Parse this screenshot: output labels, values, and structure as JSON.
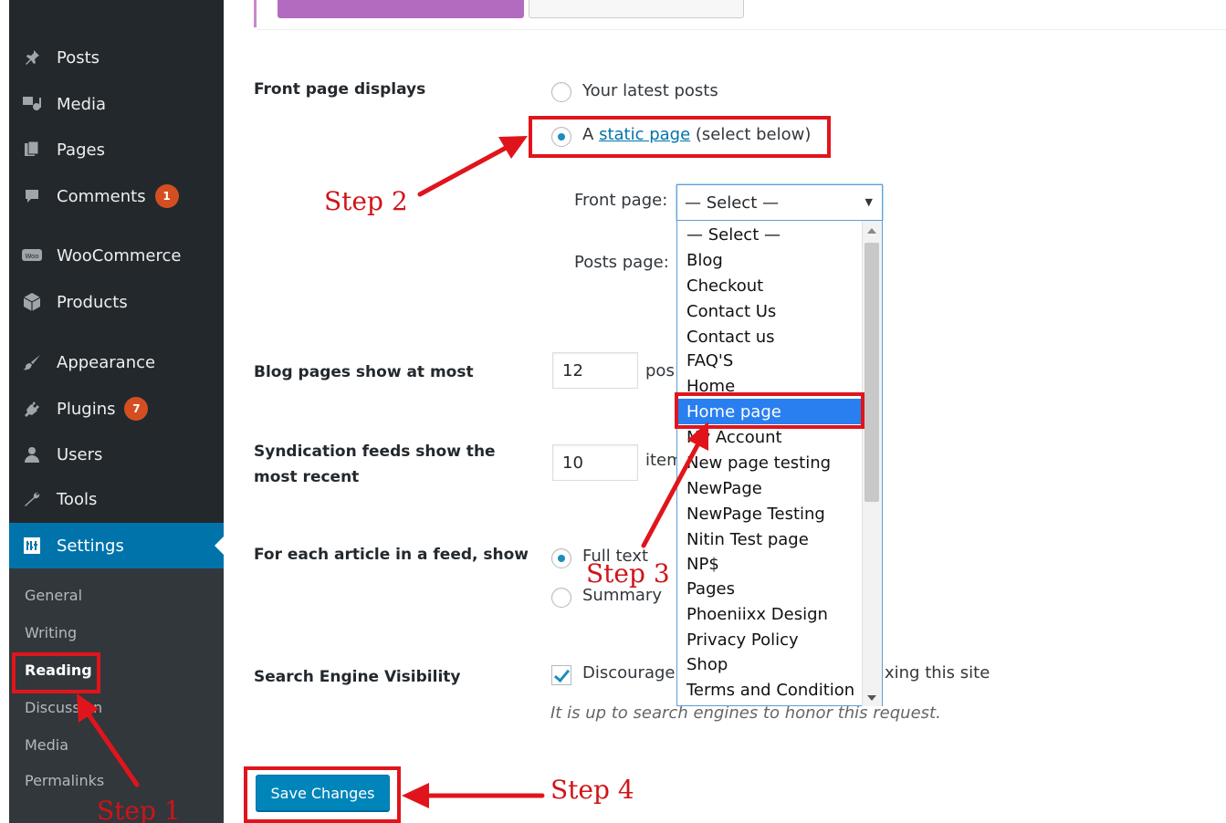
{
  "sidebar": {
    "items": [
      {
        "key": "posts",
        "label": "Posts",
        "icon": "pin-icon"
      },
      {
        "key": "media",
        "label": "Media",
        "icon": "media-icon"
      },
      {
        "key": "pages",
        "label": "Pages",
        "icon": "pages-icon"
      },
      {
        "key": "comments",
        "label": "Comments",
        "icon": "comment-icon",
        "badge": "1"
      },
      {
        "key": "woocommerce",
        "label": "WooCommerce",
        "icon": "woo-icon"
      },
      {
        "key": "products",
        "label": "Products",
        "icon": "box-icon"
      },
      {
        "key": "appearance",
        "label": "Appearance",
        "icon": "brush-icon"
      },
      {
        "key": "plugins",
        "label": "Plugins",
        "icon": "plug-icon",
        "badge": "7"
      },
      {
        "key": "users",
        "label": "Users",
        "icon": "user-icon"
      },
      {
        "key": "tools",
        "label": "Tools",
        "icon": "wrench-icon"
      },
      {
        "key": "settings",
        "label": "Settings",
        "icon": "settings-icon"
      }
    ],
    "submenu": [
      "General",
      "Writing",
      "Reading",
      "Discussion",
      "Media",
      "Permalinks"
    ],
    "current_submenu": "Reading"
  },
  "reading": {
    "front_page_displays": {
      "label": "Front page displays",
      "option_latest": "Your latest posts",
      "option_static_prefix": "A",
      "option_static_link": "static page",
      "option_static_suffix": "(select below)",
      "front_page_label": "Front page:",
      "front_page_value": "— Select —",
      "posts_page_label": "Posts page:"
    },
    "blog_pages": {
      "label": "Blog pages show at most",
      "value": "12",
      "unit": "pos"
    },
    "syndication": {
      "label_line1": "Syndication feeds show the",
      "label_line2": "most recent",
      "value": "10",
      "unit": "item"
    },
    "feed_article": {
      "label": "For each article in a feed, show",
      "option_full": "Full text",
      "option_summary": "Summary"
    },
    "search_visibility": {
      "label": "Search Engine Visibility",
      "checkbox_left": "Discourage",
      "checkbox_right": "xing this site",
      "description": "It is up to search engines to honor this request."
    },
    "save_button": "Save Changes"
  },
  "dropdown": {
    "options": [
      "— Select —",
      "Blog",
      "Checkout",
      "Contact Us",
      "Contact us",
      "FAQ'S",
      "Home",
      "Home page",
      "My Account",
      "New page testing",
      "NewPage",
      "NewPage Testing",
      "Nitin Test page",
      "NP$",
      "Pages",
      "Phoeniixx Design",
      "Privacy Policy",
      "Shop",
      "Terms and Condition"
    ],
    "highlighted": "Home page"
  },
  "annotations": {
    "step1": "Step 1",
    "step2": "Step 2",
    "step3": "Step 3",
    "step4": "Step 4"
  },
  "colors": {
    "sidebar_bg": "#23282d",
    "active_bg": "#0073aa",
    "annotation_red": "#e0151b",
    "dropdown_highlight": "#2a7ff0"
  }
}
